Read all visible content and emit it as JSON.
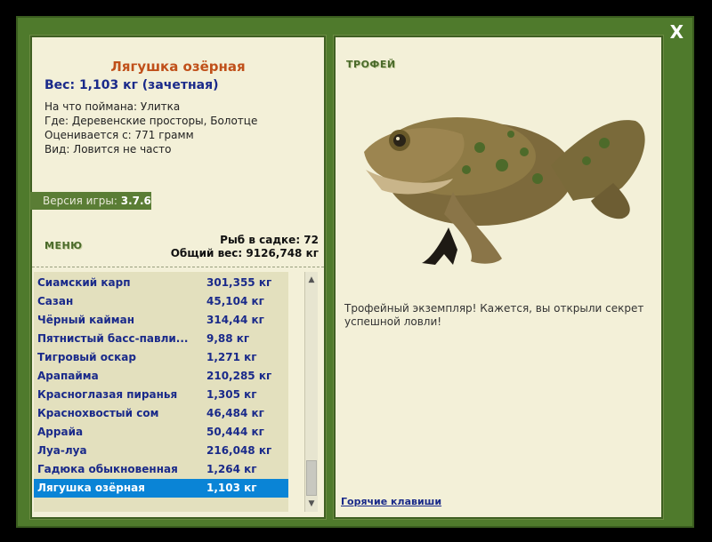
{
  "close_label": "X",
  "fish": {
    "title": "Лягушка озёрная",
    "weight": "Вес: 1,103 кг (зачетная)",
    "bait": "На что поймана: Улитка",
    "where": "Где: Деревенские просторы, Болотце",
    "valued": "Оценивается с: 771 грамм",
    "kind": "Вид: Ловится не часто"
  },
  "version": {
    "label": "Версия игры:",
    "value": "3.7.6"
  },
  "menu_label": "МЕНЮ",
  "stats": {
    "count": "Рыб в садке: 72",
    "total": "Общий вес: 9126,748 кг"
  },
  "catch_list": [
    {
      "name": "Сиамский карп",
      "weight": "301,355 кг"
    },
    {
      "name": "Сазан",
      "weight": "45,104 кг"
    },
    {
      "name": "Чёрный кайман",
      "weight": "314,44 кг"
    },
    {
      "name": "Пятнистый басс-павли...",
      "weight": "9,88 кг"
    },
    {
      "name": "Тигровый оскар",
      "weight": "1,271 кг"
    },
    {
      "name": "Арапайма",
      "weight": "210,285 кг"
    },
    {
      "name": "Красноглазая пиранья",
      "weight": "1,305 кг"
    },
    {
      "name": "Краснохвостый сом",
      "weight": "46,484 кг"
    },
    {
      "name": "Аррайа",
      "weight": "50,444 кг"
    },
    {
      "name": "Луа-луа",
      "weight": "216,048 кг"
    },
    {
      "name": "Гадюка обыкновенная",
      "weight": "1,264 кг"
    },
    {
      "name": "Лягушка озёрная",
      "weight": "1,103 кг"
    }
  ],
  "selected_index": 11,
  "trophy_label": "ТРОФЕЙ",
  "trophy_desc": "Трофейный экземпляр! Кажется, вы открыли секрет успешной ловли!",
  "hotkeys_label": "Горячие клавиши",
  "colors": {
    "frame": "#4f7a2c",
    "panel": "#f3f0d8",
    "title": "#c0501a",
    "link": "#1a2a8a",
    "selection": "#0a84d6"
  }
}
